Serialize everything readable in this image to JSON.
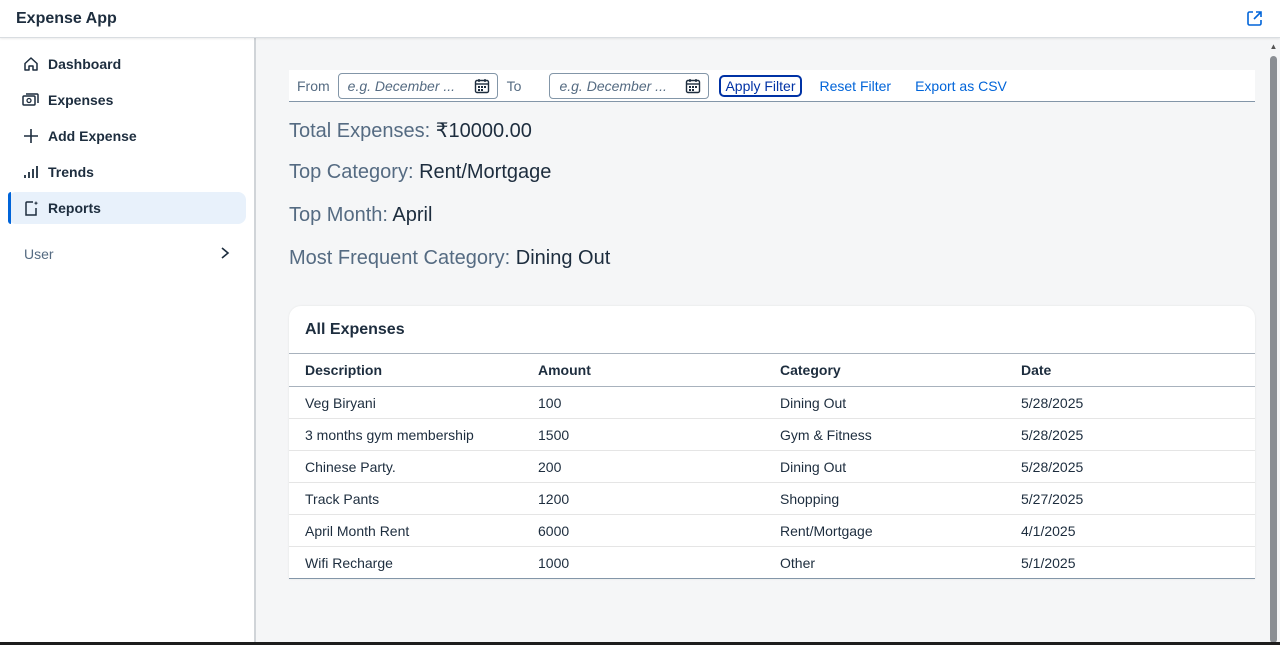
{
  "app": {
    "title": "Expense App"
  },
  "sidebar": {
    "items": [
      {
        "label": "Dashboard",
        "icon": "home-icon",
        "active": false
      },
      {
        "label": "Expenses",
        "icon": "money-bills-icon",
        "active": false
      },
      {
        "label": "Add Expense",
        "icon": "add-icon",
        "active": false
      },
      {
        "label": "Trends",
        "icon": "bar-chart-icon",
        "active": false
      },
      {
        "label": "Reports",
        "icon": "reports-icon",
        "active": true
      }
    ],
    "group": {
      "label": "User",
      "icon": "chevron-right-icon"
    }
  },
  "filter": {
    "from_label": "From",
    "to_label": "To",
    "from_placeholder": "e.g. December ...",
    "to_placeholder": "e.g. December ...",
    "apply_label": "Apply Filter",
    "reset_label": "Reset Filter",
    "export_label": "Export as CSV"
  },
  "kpis": {
    "total": {
      "label": "Total Expenses:",
      "value": "₹10000.00"
    },
    "top_category": {
      "label": "Top Category:",
      "value": "Rent/Mortgage"
    },
    "top_month": {
      "label": "Top Month:",
      "value": "April"
    },
    "frequent": {
      "label": "Most Frequent Category:",
      "value": "Dining Out"
    }
  },
  "table": {
    "title": "All Expenses",
    "columns": [
      "Description",
      "Amount",
      "Category",
      "Date"
    ],
    "rows": [
      [
        "Veg Biryani",
        "100",
        "Dining Out",
        "5/28/2025"
      ],
      [
        "3 months gym membership",
        "1500",
        "Gym & Fitness",
        "5/28/2025"
      ],
      [
        "Chinese Party.",
        "200",
        "Dining Out",
        "5/28/2025"
      ],
      [
        "Track Pants",
        "1200",
        "Shopping",
        "5/27/2025"
      ],
      [
        "April Month Rent",
        "6000",
        "Rent/Mortgage",
        "4/1/2025"
      ],
      [
        "Wifi Recharge",
        "1000",
        "Other",
        "5/1/2025"
      ]
    ]
  },
  "colors": {
    "accent": "#0064d9",
    "text": "#1d2d3e",
    "muted": "#556b82",
    "active_bg": "#e8f1fb",
    "background": "#f5f6f7"
  }
}
